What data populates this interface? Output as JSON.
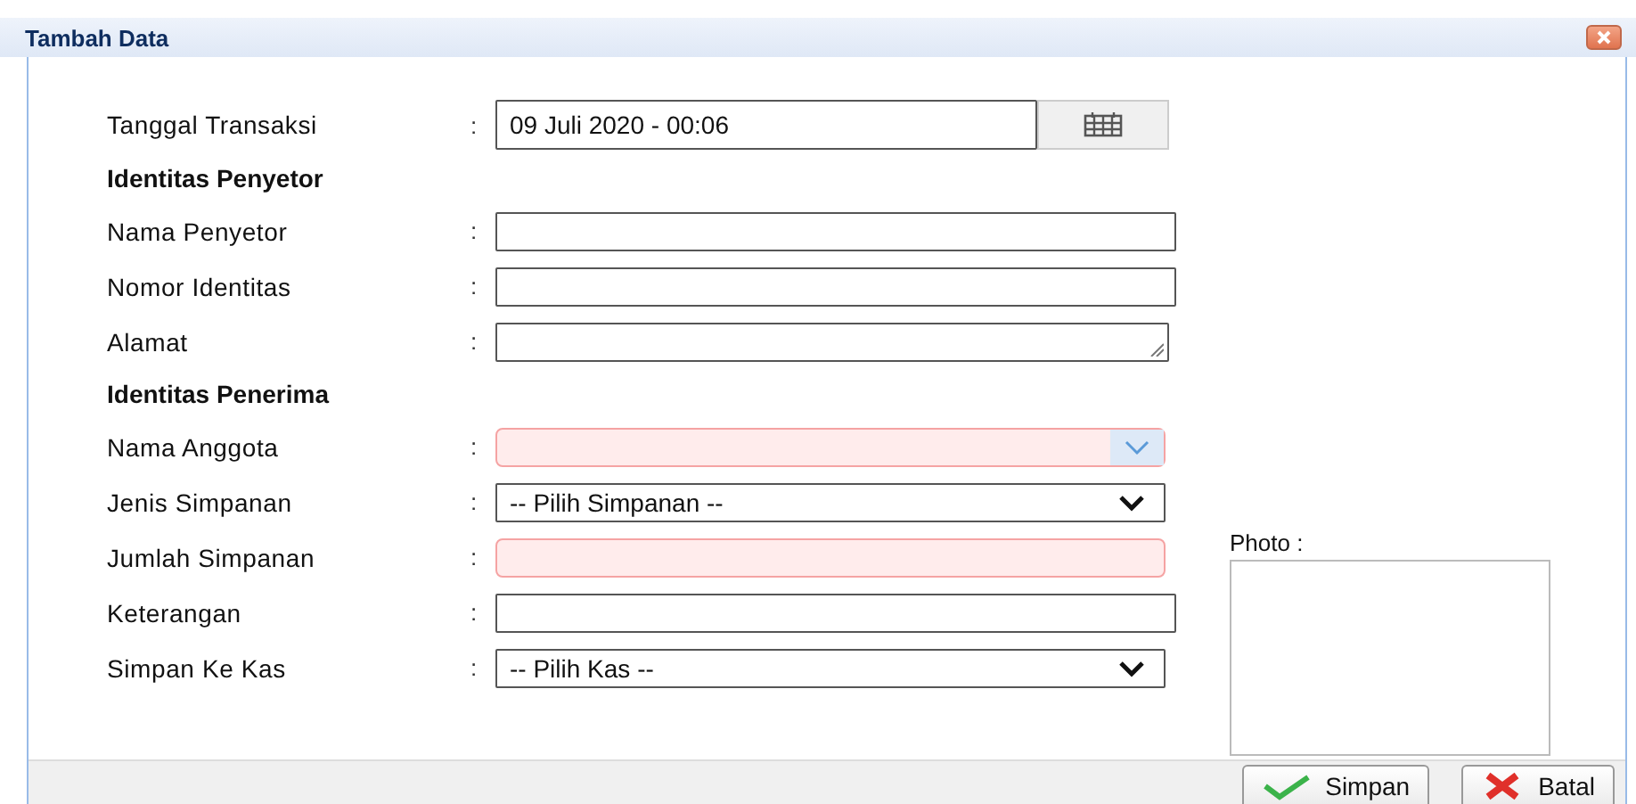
{
  "window": {
    "title": "Tambah Data"
  },
  "sections": [
    {
      "kind": "field",
      "label": "Tanggal Transaksi",
      "colon": ":",
      "field": {
        "kind": "date",
        "value": "09 Juli 2020 - 00:06",
        "invalid": false
      }
    },
    {
      "kind": "heading",
      "label": "Identitas Penyetor"
    },
    {
      "kind": "field",
      "label": "Nama Penyetor",
      "colon": ":",
      "field": {
        "kind": "text",
        "invalid": false
      }
    },
    {
      "kind": "field",
      "label": "Nomor Identitas",
      "colon": ":",
      "field": {
        "kind": "text",
        "invalid": false
      }
    },
    {
      "kind": "field",
      "label": "Alamat",
      "colon": ":",
      "field": {
        "kind": "textarea",
        "invalid": false
      }
    },
    {
      "kind": "heading",
      "label": "Identitas Penerima"
    },
    {
      "kind": "field",
      "label": "Nama Anggota",
      "colon": ":",
      "field": {
        "kind": "combo",
        "invalid": true
      }
    },
    {
      "kind": "field",
      "label": "Jenis Simpanan",
      "colon": ":",
      "field": {
        "kind": "select",
        "value": "-- Pilih Simpanan --",
        "invalid": false
      }
    },
    {
      "kind": "field",
      "label": "Jumlah Simpanan",
      "colon": ":",
      "field": {
        "kind": "text",
        "invalid": true
      }
    },
    {
      "kind": "field",
      "label": "Keterangan",
      "colon": ":",
      "field": {
        "kind": "text",
        "invalid": false
      }
    },
    {
      "kind": "field",
      "label": "Simpan Ke Kas",
      "colon": ":",
      "field": {
        "kind": "select",
        "value": "-- Pilih Kas --",
        "invalid": false
      }
    }
  ],
  "photo": {
    "label": "Photo :"
  },
  "buttons": [
    {
      "kind": "save",
      "label": "Simpan"
    },
    {
      "kind": "cancel",
      "label": "Batal"
    }
  ]
}
